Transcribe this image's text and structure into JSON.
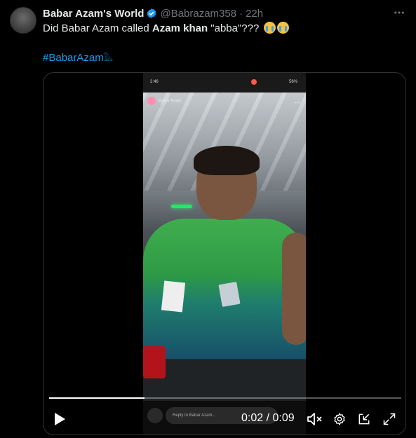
{
  "tweet": {
    "display_name": "Babar Azam's World",
    "handle": "@Babrazam358",
    "separator": "·",
    "time": "22h",
    "text_prefix": "Did Babar Azam called ",
    "text_bold": "Azam khan",
    "text_suffix": " \"abba\"??? ",
    "hashtag": "#BabarAzam",
    "hashtag_suffix": "𓅓",
    "more_icon": "more-horizontal-icon"
  },
  "video": {
    "progress_fraction": 0.27,
    "timecode": "0:02 / 0:09",
    "story": {
      "status_time": "2:46",
      "status_right": "56%",
      "username": "Babar Azam",
      "ago": "1h ago",
      "reply_placeholder": "Reply to Babar Azam..."
    },
    "controls": {
      "play_icon": "play-icon",
      "mute_icon": "volume-muted-icon",
      "settings_icon": "settings-gear-icon",
      "exit_icon": "picture-in-picture-icon",
      "fullscreen_icon": "fullscreen-icon"
    }
  },
  "colors": {
    "background": "#000000",
    "text": "#e7e9ea",
    "muted": "#71767b",
    "link": "#1d9bf0",
    "verified": "#1d9bf0"
  }
}
